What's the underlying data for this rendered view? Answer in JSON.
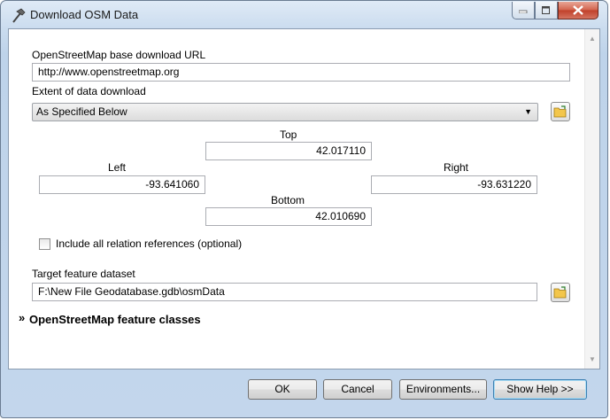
{
  "window": {
    "title": "Download OSM Data",
    "icons": {
      "app": "hammer-icon",
      "minimize": "minimize-icon",
      "maximize": "maximize-icon",
      "close": "close-icon"
    }
  },
  "form": {
    "url_label": "OpenStreetMap base download URL",
    "url_value": "http://www.openstreetmap.org",
    "extent_label": "Extent of data download",
    "extent_value": "As Specified Below",
    "top_label": "Top",
    "top_value": "42.017110",
    "left_label": "Left",
    "left_value": "-93.641060",
    "right_label": "Right",
    "right_value": "-93.631220",
    "bottom_label": "Bottom",
    "bottom_value": "42.010690",
    "relation_label": "Include all relation references (optional)",
    "relation_checked": false,
    "target_label": "Target feature dataset",
    "target_value": "F:\\New File Geodatabase.gdb\\osmData",
    "feature_classes_header": "OpenStreetMap feature classes"
  },
  "buttons": {
    "ok": "OK",
    "cancel": "Cancel",
    "environments": "Environments...",
    "show_help": "Show Help >>"
  },
  "colors": {
    "close_button": "#c94a33",
    "frame": "#c3d6ec"
  }
}
